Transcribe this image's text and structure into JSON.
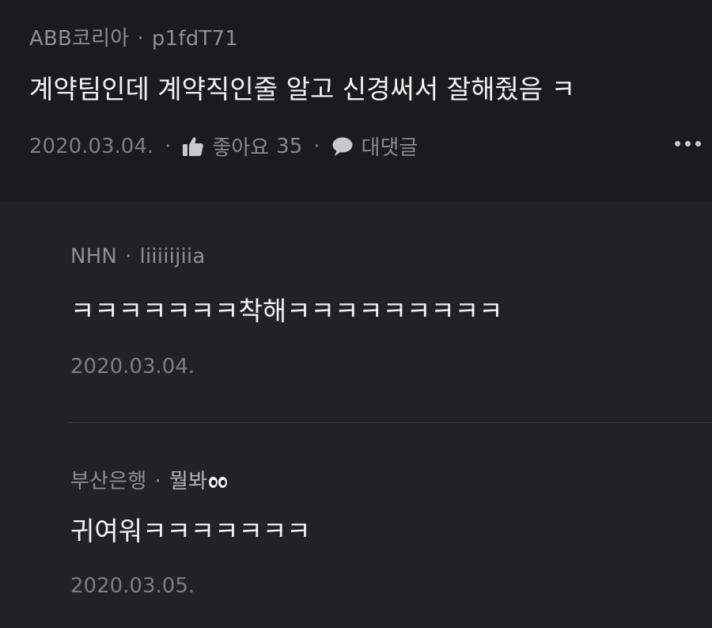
{
  "main_comment": {
    "company": "ABB코리아",
    "username": "p1fdT71",
    "text": "계약팀인데 계약직인줄 알고 신경써서 잘해줬음 ㅋ",
    "date": "2020.03.04.",
    "like_label": "좋아요",
    "like_count": "35",
    "reply_label": "대댓글",
    "icons": [
      "thumbs-up-icon",
      "speech-bubble-icon",
      "more-options-icon"
    ]
  },
  "replies": [
    {
      "company": "NHN",
      "username": "liiiiijiia",
      "text": "ㅋㅋㅋㅋㅋㅋㅋ착해ㅋㅋㅋㅋㅋㅋㅋㅋㅋ",
      "date": "2020.03.04."
    },
    {
      "company": "부산은행",
      "username": "뭘봐",
      "username_emoji": "eyes-icon",
      "text": "귀여워ㅋㅋㅋㅋㅋㅋㅋ",
      "date": "2020.03.05."
    }
  ],
  "meta_separator": "·"
}
